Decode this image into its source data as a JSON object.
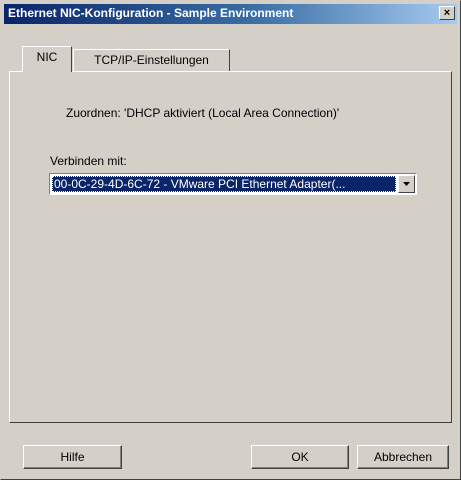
{
  "window": {
    "title": "Ethernet NIC-Konfiguration - Sample Environment",
    "close_glyph": "×"
  },
  "tabs": [
    {
      "label": "NIC",
      "selected": true
    },
    {
      "label": "TCP/IP-Einstellungen",
      "selected": false
    }
  ],
  "nic": {
    "assign_text": "Zuordnen: 'DHCP aktiviert (Local Area Connection)'",
    "connect_label": "Verbinden mit:",
    "connect_value": "00-0C-29-4D-6C-72 - VMware PCI Ethernet Adapter(..."
  },
  "buttons": {
    "help": "Hilfe",
    "ok": "OK",
    "cancel": "Abbrechen"
  },
  "colors": {
    "title_bar": "#0a246a",
    "face": "#d4d0c8",
    "selection": "#0a246a"
  },
  "icons": {
    "close": "close-icon",
    "dropdown": "chevron-down-icon"
  }
}
